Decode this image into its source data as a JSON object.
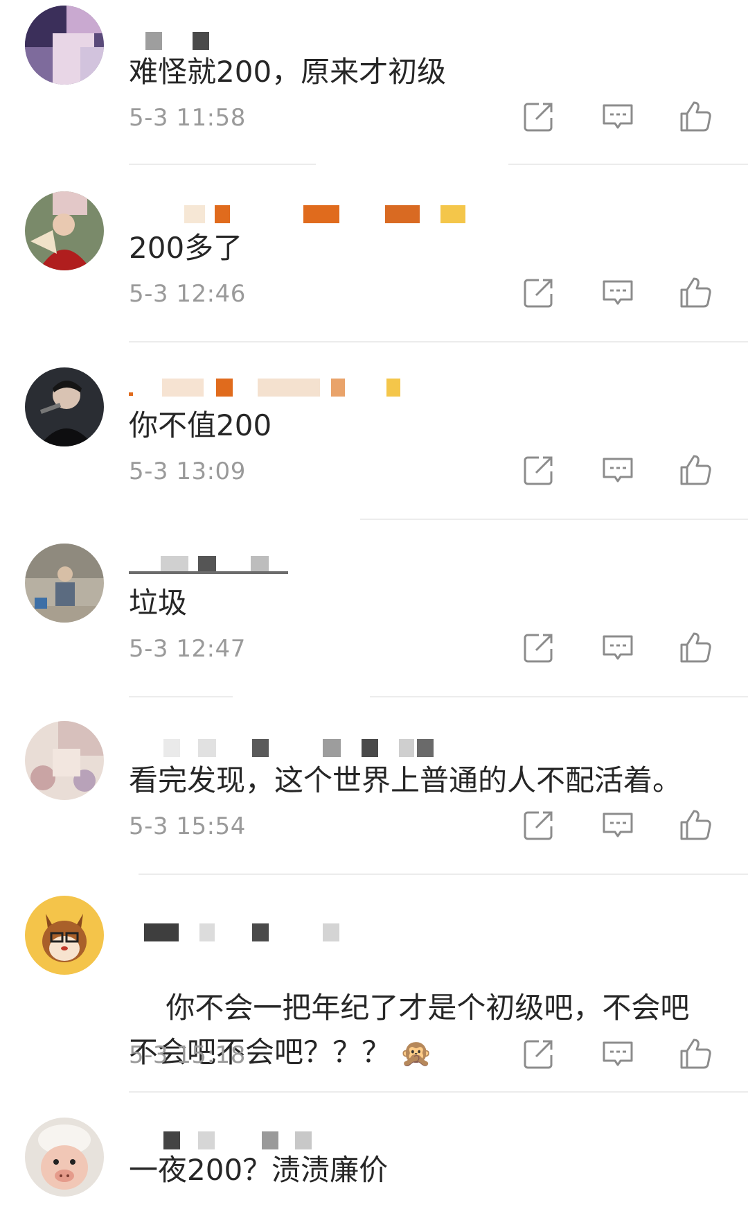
{
  "comments": [
    {
      "text": "难怪就200，原来才初级",
      "time": "5-3 11:58",
      "avatar": "blurred-portrait",
      "username": ""
    },
    {
      "text": "200多了",
      "time": "5-3 12:46",
      "avatar": "woman-in-red-with-fan",
      "username": ""
    },
    {
      "text": "你不值200",
      "time": "5-3 13:09",
      "avatar": "singer-with-microphone",
      "username": ""
    },
    {
      "text": "垃圾",
      "time": "5-3 12:47",
      "avatar": "person-sitting-outdoors",
      "username": ""
    },
    {
      "text": "看完发现，这个世界上普通的人不配活着。",
      "time": "5-3 15:54",
      "avatar": "blurred-floral",
      "username": ""
    },
    {
      "text": "你不会一把年纪了才是个初级吧，不会吧不会吧不会吧？？？",
      "emoji": "🙊",
      "time": "5-3 15:18",
      "avatar": "cartoon-chipmunk",
      "username": ""
    },
    {
      "text": "一夜200？渍渍廉价",
      "time": "",
      "avatar": "pig-with-towel",
      "username": ""
    }
  ],
  "icons": {
    "share": "share-icon",
    "reply": "reply-icon",
    "like": "thumbs-up-icon"
  },
  "colors": {
    "text": "#262626",
    "time": "#9a9a9a",
    "icon": "#8c8c8c",
    "username_accent": "#e07a1f"
  }
}
